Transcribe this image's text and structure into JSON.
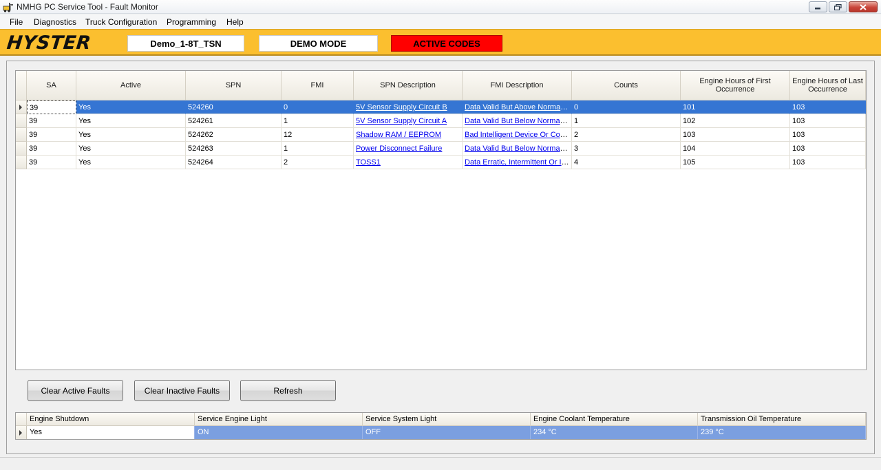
{
  "window": {
    "title": "NMHG PC Service Tool - Fault Monitor"
  },
  "menu": {
    "items": [
      "File",
      "Diagnostics",
      "Truck Configuration",
      "Programming",
      "Help"
    ]
  },
  "brand": {
    "logo_text": "HYSTER",
    "truck_name": "Demo_1-8T_TSN",
    "mode": "DEMO MODE",
    "codes_status": "ACTIVE CODES",
    "accent_color": "#fbbf2f",
    "alert_color": "#ff0000"
  },
  "fault_table": {
    "columns": [
      "SA",
      "Active",
      "SPN",
      "FMI",
      "SPN Description",
      "FMI Description",
      "Counts",
      "Engine Hours of First Occurrence",
      "Engine Hours of Last Occurrence"
    ],
    "rows": [
      {
        "sa": "39",
        "active": "Yes",
        "spn": "524260",
        "fmi": "0",
        "spn_desc": "5V Sensor Supply Circuit B",
        "fmi_desc": "Data Valid But Above Normal O...",
        "counts": "0",
        "first": "101",
        "last": "103"
      },
      {
        "sa": "39",
        "active": "Yes",
        "spn": "524261",
        "fmi": "1",
        "spn_desc": "5V Sensor Supply Circuit A",
        "fmi_desc": "Data Valid But Below Normal Op...",
        "counts": "1",
        "first": "102",
        "last": "103"
      },
      {
        "sa": "39",
        "active": "Yes",
        "spn": "524262",
        "fmi": "12",
        "spn_desc": "Shadow RAM / EEPROM",
        "fmi_desc": "Bad Intelligent Device Or Comp...",
        "counts": "2",
        "first": "103",
        "last": "103"
      },
      {
        "sa": "39",
        "active": "Yes",
        "spn": "524263",
        "fmi": "1",
        "spn_desc": "Power Disconnect Failure",
        "fmi_desc": "Data Valid But Below Normal Op...",
        "counts": "3",
        "first": "104",
        "last": "103"
      },
      {
        "sa": "39",
        "active": "Yes",
        "spn": "524264",
        "fmi": "2",
        "spn_desc": "TOSS1",
        "fmi_desc": "Data Erratic, Intermittent Or In...",
        "counts": "4",
        "first": "105",
        "last": "103"
      }
    ]
  },
  "buttons": {
    "clear_active": "Clear Active Faults",
    "clear_inactive": "Clear Inactive Faults",
    "refresh": "Refresh"
  },
  "status_table": {
    "columns": [
      "Engine Shutdown",
      "Service Engine Light",
      "Service System Light",
      "Engine Coolant Temperature",
      "Transmission Oil Temperature"
    ],
    "values": [
      "Yes",
      "ON",
      "OFF",
      "234 °C",
      "239 °C"
    ]
  }
}
